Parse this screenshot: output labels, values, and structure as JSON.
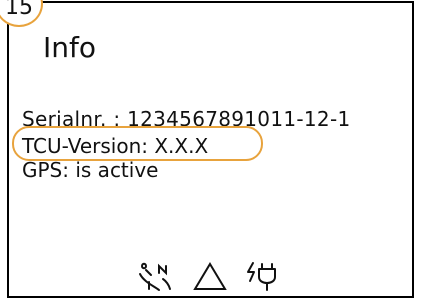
{
  "callout": {
    "number": "15"
  },
  "screen": {
    "title": "Info",
    "lines": {
      "serial": "Serialnr. : 1234567891011-12-1",
      "tcu": "TCU-Version: X.X.X",
      "gps": "GPS: is active"
    }
  },
  "status_bar": {
    "icons": [
      "satellite-north-icon",
      "warning-triangle-icon",
      "power-plug-icon"
    ]
  },
  "colors": {
    "accent": "#E8A33D",
    "border": "#000000",
    "text": "#111111",
    "background": "#FFFFFF"
  }
}
